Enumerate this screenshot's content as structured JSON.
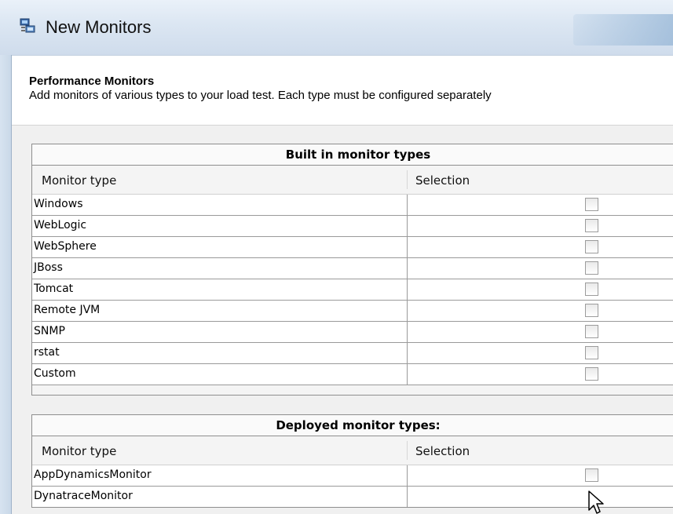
{
  "window": {
    "title": "New Monitors"
  },
  "header": {
    "title": "Performance Monitors",
    "description": "Add monitors of various types to your load test.  Each type must be configured separately"
  },
  "built_in": {
    "title": "Built in monitor types",
    "columns": {
      "type": "Monitor type",
      "selection": "Selection"
    },
    "rows": [
      {
        "label": "Windows",
        "checked": false
      },
      {
        "label": "WebLogic",
        "checked": false
      },
      {
        "label": "WebSphere",
        "checked": false
      },
      {
        "label": "JBoss",
        "checked": false
      },
      {
        "label": "Tomcat",
        "checked": false
      },
      {
        "label": "Remote JVM",
        "checked": false
      },
      {
        "label": "SNMP",
        "checked": false
      },
      {
        "label": "rstat",
        "checked": false
      },
      {
        "label": "Custom",
        "checked": false
      }
    ]
  },
  "deployed": {
    "title": "Deployed monitor types:",
    "columns": {
      "type": "Monitor type",
      "selection": "Selection"
    },
    "rows": [
      {
        "label": "AppDynamicsMonitor",
        "checked": false
      },
      {
        "label": "DynatraceMonitor",
        "checked": false
      }
    ]
  },
  "icons": {
    "app": "monitors-app-icon",
    "cursor": "mouse-pointer-icon"
  }
}
